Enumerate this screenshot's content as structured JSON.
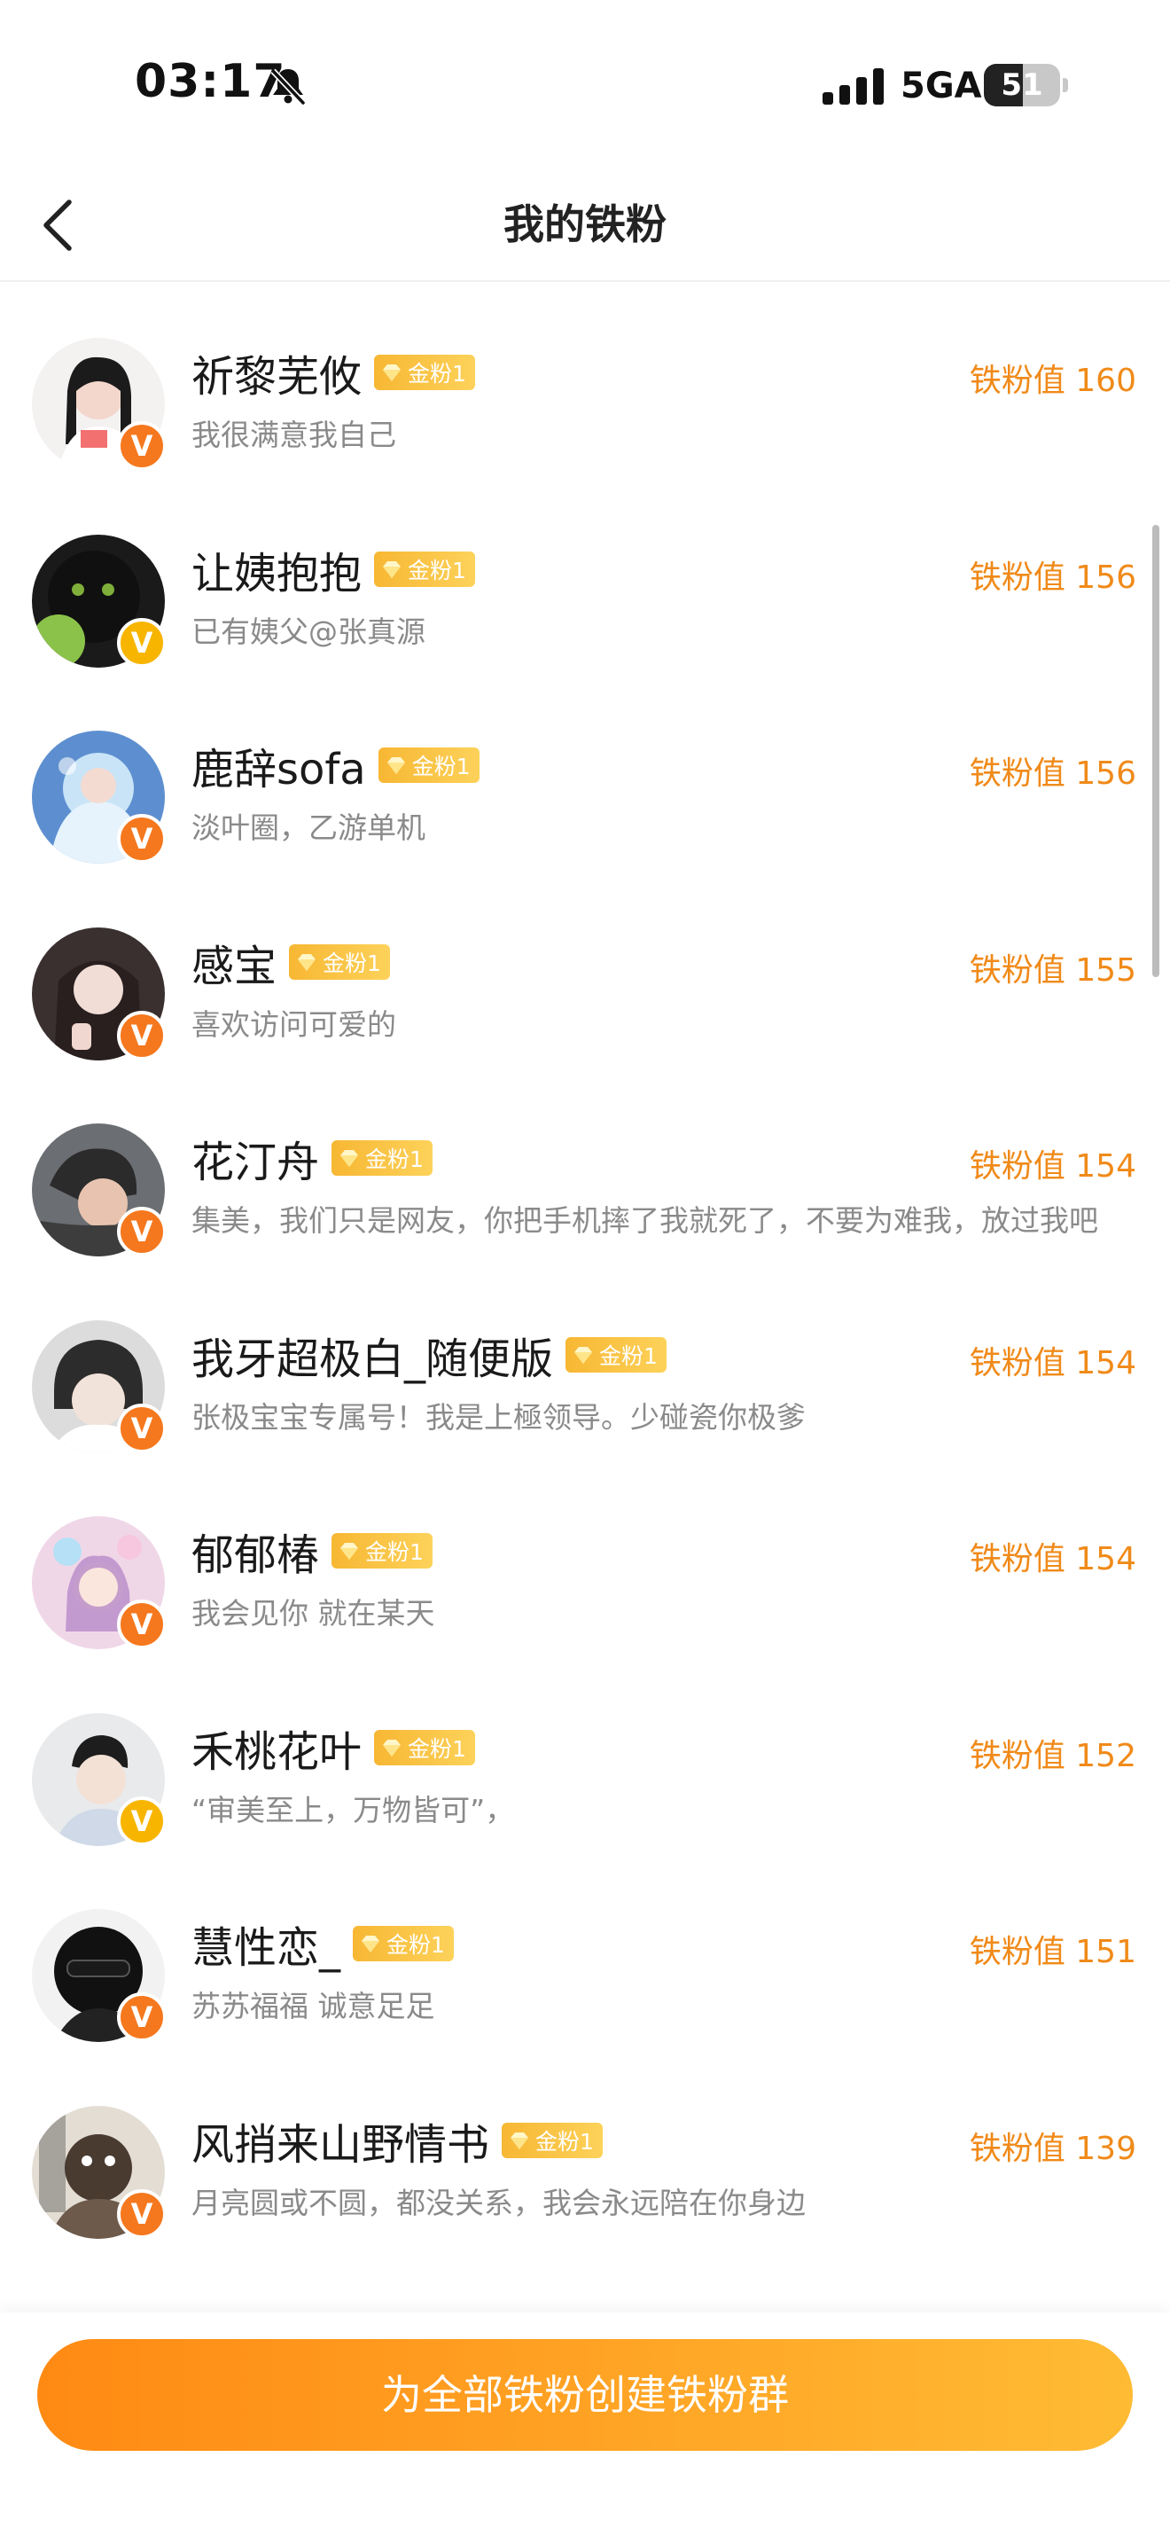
{
  "status_bar": {
    "time": "03:17",
    "network": "5GA",
    "battery_level": 51,
    "battery_text": "51",
    "icons": [
      "bell-slash-icon",
      "signal-icon",
      "battery-icon"
    ]
  },
  "nav": {
    "title": "我的铁粉",
    "back_icon": "chevron-left-icon"
  },
  "colors": {
    "accent_orange": "#f08a19",
    "gold_badge": "#f7b733",
    "verified_orange": "#f5781e",
    "verified_yellow": "#f7b500",
    "button_gradient_start": "#ff8a13",
    "button_gradient_end": "#ffbb34"
  },
  "fans": [
    {
      "name": "祈黎芜攸",
      "badge": "金粉1",
      "bio": "我很满意我自己",
      "value_text": "铁粉值 160",
      "verified": "orange"
    },
    {
      "name": "让姨抱抱",
      "badge": "金粉1",
      "bio": "已有姨父@张真源",
      "value_text": "铁粉值 156",
      "verified": "yellow"
    },
    {
      "name": "鹿辞sofa",
      "badge": "金粉1",
      "bio": "淡叶圈，乙游单机",
      "value_text": "铁粉值 156",
      "verified": "orange"
    },
    {
      "name": "感宝",
      "badge": "金粉1",
      "bio": "喜欢访问可爱的",
      "value_text": "铁粉值 155",
      "verified": "orange"
    },
    {
      "name": "花汀舟",
      "badge": "金粉1",
      "bio": "集美，我们只是网友，你把手机摔了我就死了，不要为难我，放过我吧",
      "value_text": "铁粉值 154",
      "verified": "orange"
    },
    {
      "name": "我牙超极白_随便版",
      "badge": "金粉1",
      "bio": "张极宝宝专属号！我是上極领导。少碰瓷你极爹",
      "value_text": "铁粉值 154",
      "verified": "orange"
    },
    {
      "name": "郁郁椿",
      "badge": "金粉1",
      "bio": "我会见你 就在某天",
      "value_text": "铁粉值 154",
      "verified": "orange"
    },
    {
      "name": "禾桃花叶",
      "badge": "金粉1",
      "bio": "“审美至上，万物皆可”，",
      "value_text": "铁粉值 152",
      "verified": "yellow"
    },
    {
      "name": "慧性恋_",
      "badge": "金粉1",
      "bio": "苏苏福福 诚意足足",
      "value_text": "铁粉值 151",
      "verified": "orange"
    },
    {
      "name": "风捎来山野情书",
      "badge": "金粉1",
      "bio": "月亮圆或不圆，都没关系，我会永远陪在你身边",
      "value_text": "铁粉值 139",
      "verified": "orange"
    }
  ],
  "bottom": {
    "button_label": "为全部铁粉创建铁粉群"
  }
}
